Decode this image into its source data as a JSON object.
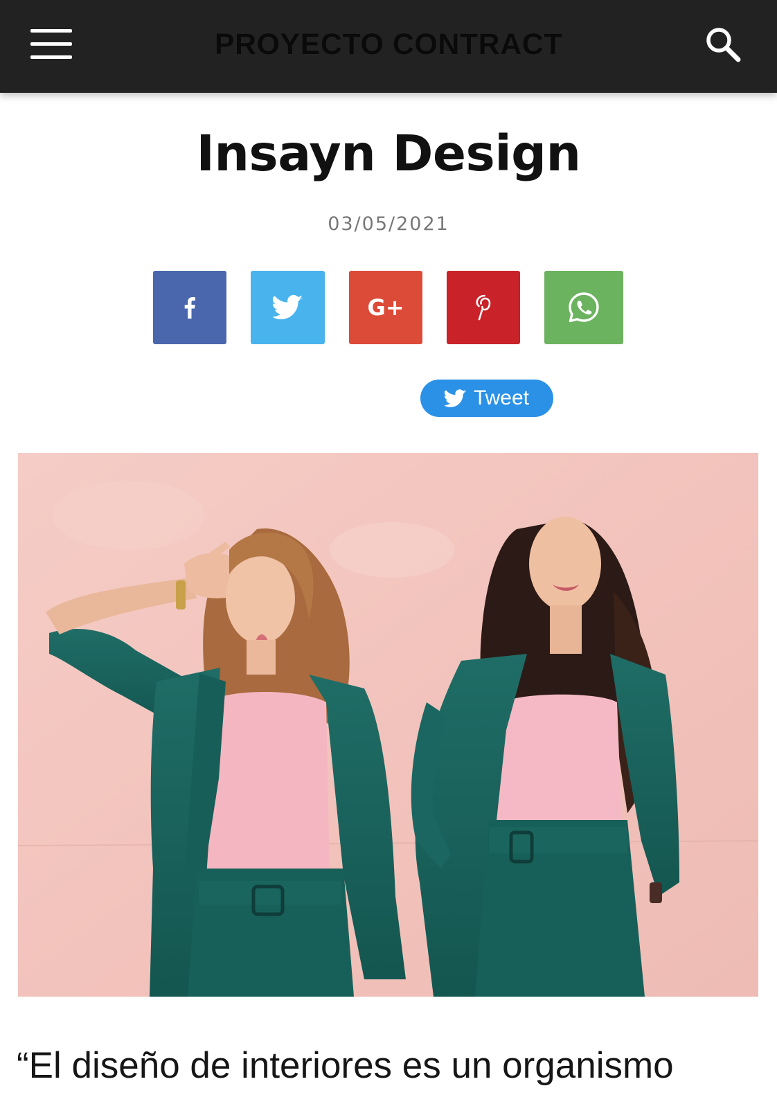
{
  "header": {
    "brand": "PROYECTO CONTRACT",
    "menu_icon": "hamburger-menu-icon",
    "search_icon": "search-icon",
    "background": "#222222"
  },
  "article": {
    "title": "Insayn Design",
    "date": "03/05/2021",
    "quote_start": "“El diseño de interiores es un organismo"
  },
  "share": {
    "buttons": [
      {
        "network": "facebook",
        "icon": "facebook-icon",
        "label": "f",
        "color": "#4a67ad"
      },
      {
        "network": "twitter",
        "icon": "twitter-bird-icon",
        "color": "#48b3ec"
      },
      {
        "network": "google-plus",
        "icon": "google-plus-icon",
        "label": "G+",
        "color": "#dc4a38"
      },
      {
        "network": "pinterest",
        "icon": "pinterest-icon",
        "color": "#c92228"
      },
      {
        "network": "whatsapp",
        "icon": "whatsapp-icon",
        "color": "#6cb35f"
      }
    ],
    "tweet_label": "Tweet",
    "tweet_color": "#2a91e6"
  },
  "hero_image": {
    "subject": "two women in teal suits and pink tops posing against a pink wall"
  }
}
